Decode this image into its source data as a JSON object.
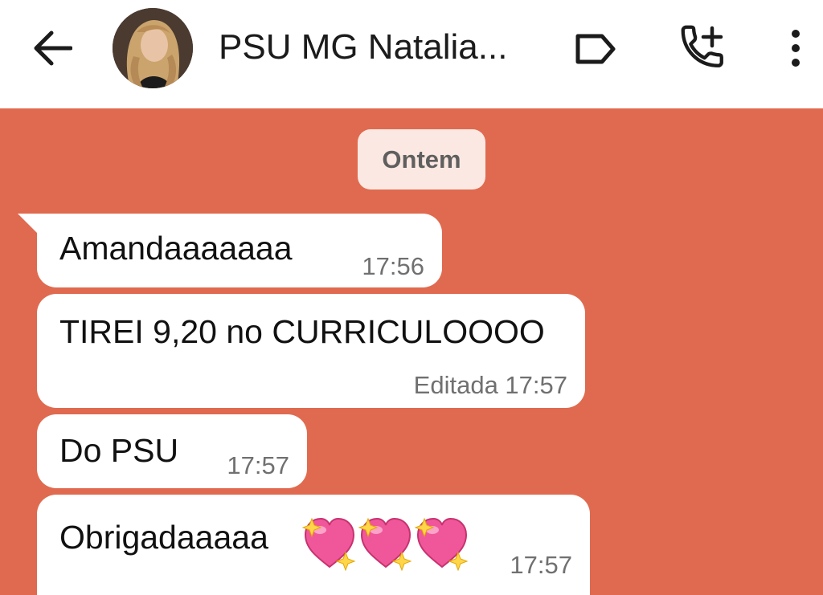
{
  "header": {
    "contact_name": "PSU MG Natalia...",
    "icons": [
      "arrow-back-icon",
      "avatar",
      "label-icon",
      "add-call-icon",
      "more-vertical-icon"
    ]
  },
  "chat": {
    "date_divider": "Ontem",
    "messages": [
      {
        "text": "Amandaaaaaaa",
        "time": "17:56"
      },
      {
        "text": "TIREI 9,20 no CURRICULOOOO",
        "time": "Editada 17:57"
      },
      {
        "text": "Do PSU",
        "time": "17:57"
      },
      {
        "text": "Obrigadaaaaa",
        "emoji": "sparkling-heart-emoji x3",
        "time": "17:57"
      }
    ]
  },
  "colors": {
    "wallpaper": "#E06A4F",
    "bubble": "#FFFFFF",
    "date_chip": "#FCE8E2",
    "header": "#FFFFFF"
  }
}
